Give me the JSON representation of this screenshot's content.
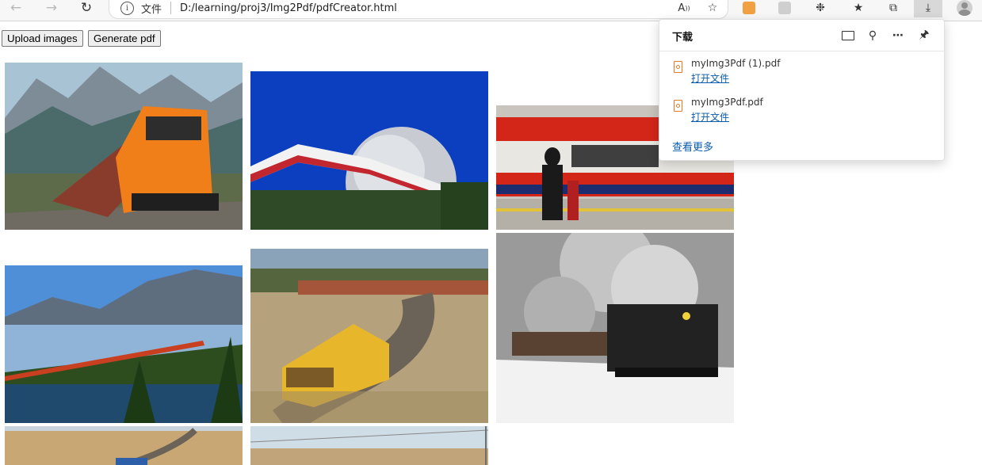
{
  "browser": {
    "scheme_label": "文件",
    "address": "D:/learning/proj3/Img2Pdf/pdfCreator.html"
  },
  "page": {
    "upload_label": "Upload images",
    "generate_label": "Generate pdf"
  },
  "downloads": {
    "title": "下载",
    "items": [
      {
        "name": "myImg3Pdf (1).pdf",
        "open_label": "打开文件"
      },
      {
        "name": "myImg3Pdf.pdf",
        "open_label": "打开文件"
      }
    ],
    "see_more_label": "查看更多"
  },
  "icons": {
    "back": "back-arrow-icon",
    "forward": "forward-arrow-icon",
    "refresh": "refresh-icon",
    "info": "info-icon",
    "read_aloud": "read-aloud-icon",
    "favorite_add": "add-favorite-icon",
    "extension1": "extension-orange-icon",
    "extension2": "extension-grey-icon",
    "extensions": "puzzle-icon",
    "favorites": "favorites-icon",
    "collections": "collections-icon",
    "downloads": "download-icon",
    "profile": "avatar",
    "folder": "folder-icon",
    "search": "search-icon",
    "more": "more-icon",
    "pin": "pin-icon"
  },
  "colors": {
    "link": "#0b5cad",
    "pdf_accent": "#e07d2a"
  }
}
